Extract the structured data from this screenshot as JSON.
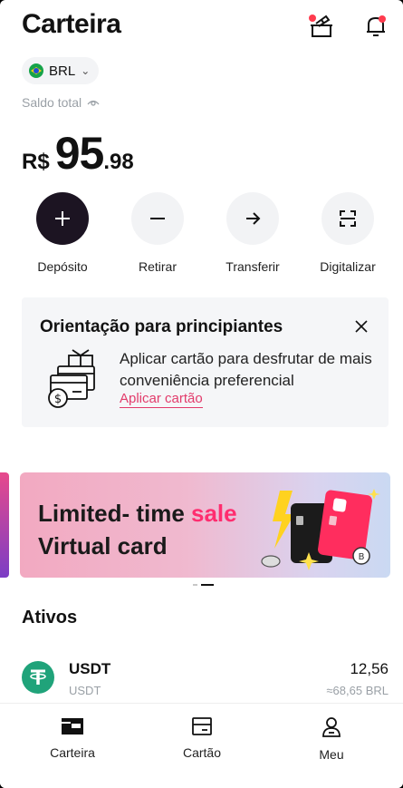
{
  "header": {
    "title": "Carteira",
    "gift_icon": "gift-icon",
    "bell_icon": "bell-icon"
  },
  "currency": {
    "code": "BRL",
    "flag": "brazil-flag-icon"
  },
  "balance": {
    "label": "Saldo total",
    "currency_symbol": "R$",
    "integer": "95",
    "decimal": ".98"
  },
  "actions": [
    {
      "label": "Depósito",
      "icon": "plus-icon"
    },
    {
      "label": "Retirar",
      "icon": "minus-icon"
    },
    {
      "label": "Transferir",
      "icon": "arrow-right-icon"
    },
    {
      "label": "Digitalizar",
      "icon": "scan-icon"
    }
  ],
  "guide": {
    "title": "Orientação para principiantes",
    "description": "Aplicar cartão para desfrutar de mais conveniência preferencial",
    "link": "Aplicar cartão"
  },
  "banner": {
    "line1_prefix": "Limited- time ",
    "line1_highlight": "sale",
    "line2": "Virtual card"
  },
  "assets": {
    "title": "Ativos",
    "items": [
      {
        "name": "USDT",
        "subtitle": "USDT",
        "amount": "12,56",
        "converted": "≈68,65 BRL"
      }
    ]
  },
  "nav": [
    {
      "label": "Carteira",
      "icon": "wallet-icon",
      "active": true
    },
    {
      "label": "Cartão",
      "icon": "card-icon",
      "active": false
    },
    {
      "label": "Meu",
      "icon": "profile-icon",
      "active": false
    }
  ],
  "colors": {
    "accent_pink": "#ff2d6f",
    "link_pink": "#e23b6b",
    "usdt_green": "#20a37a",
    "dark_button": "#1c1422",
    "notification_red": "#ff3b4e"
  }
}
